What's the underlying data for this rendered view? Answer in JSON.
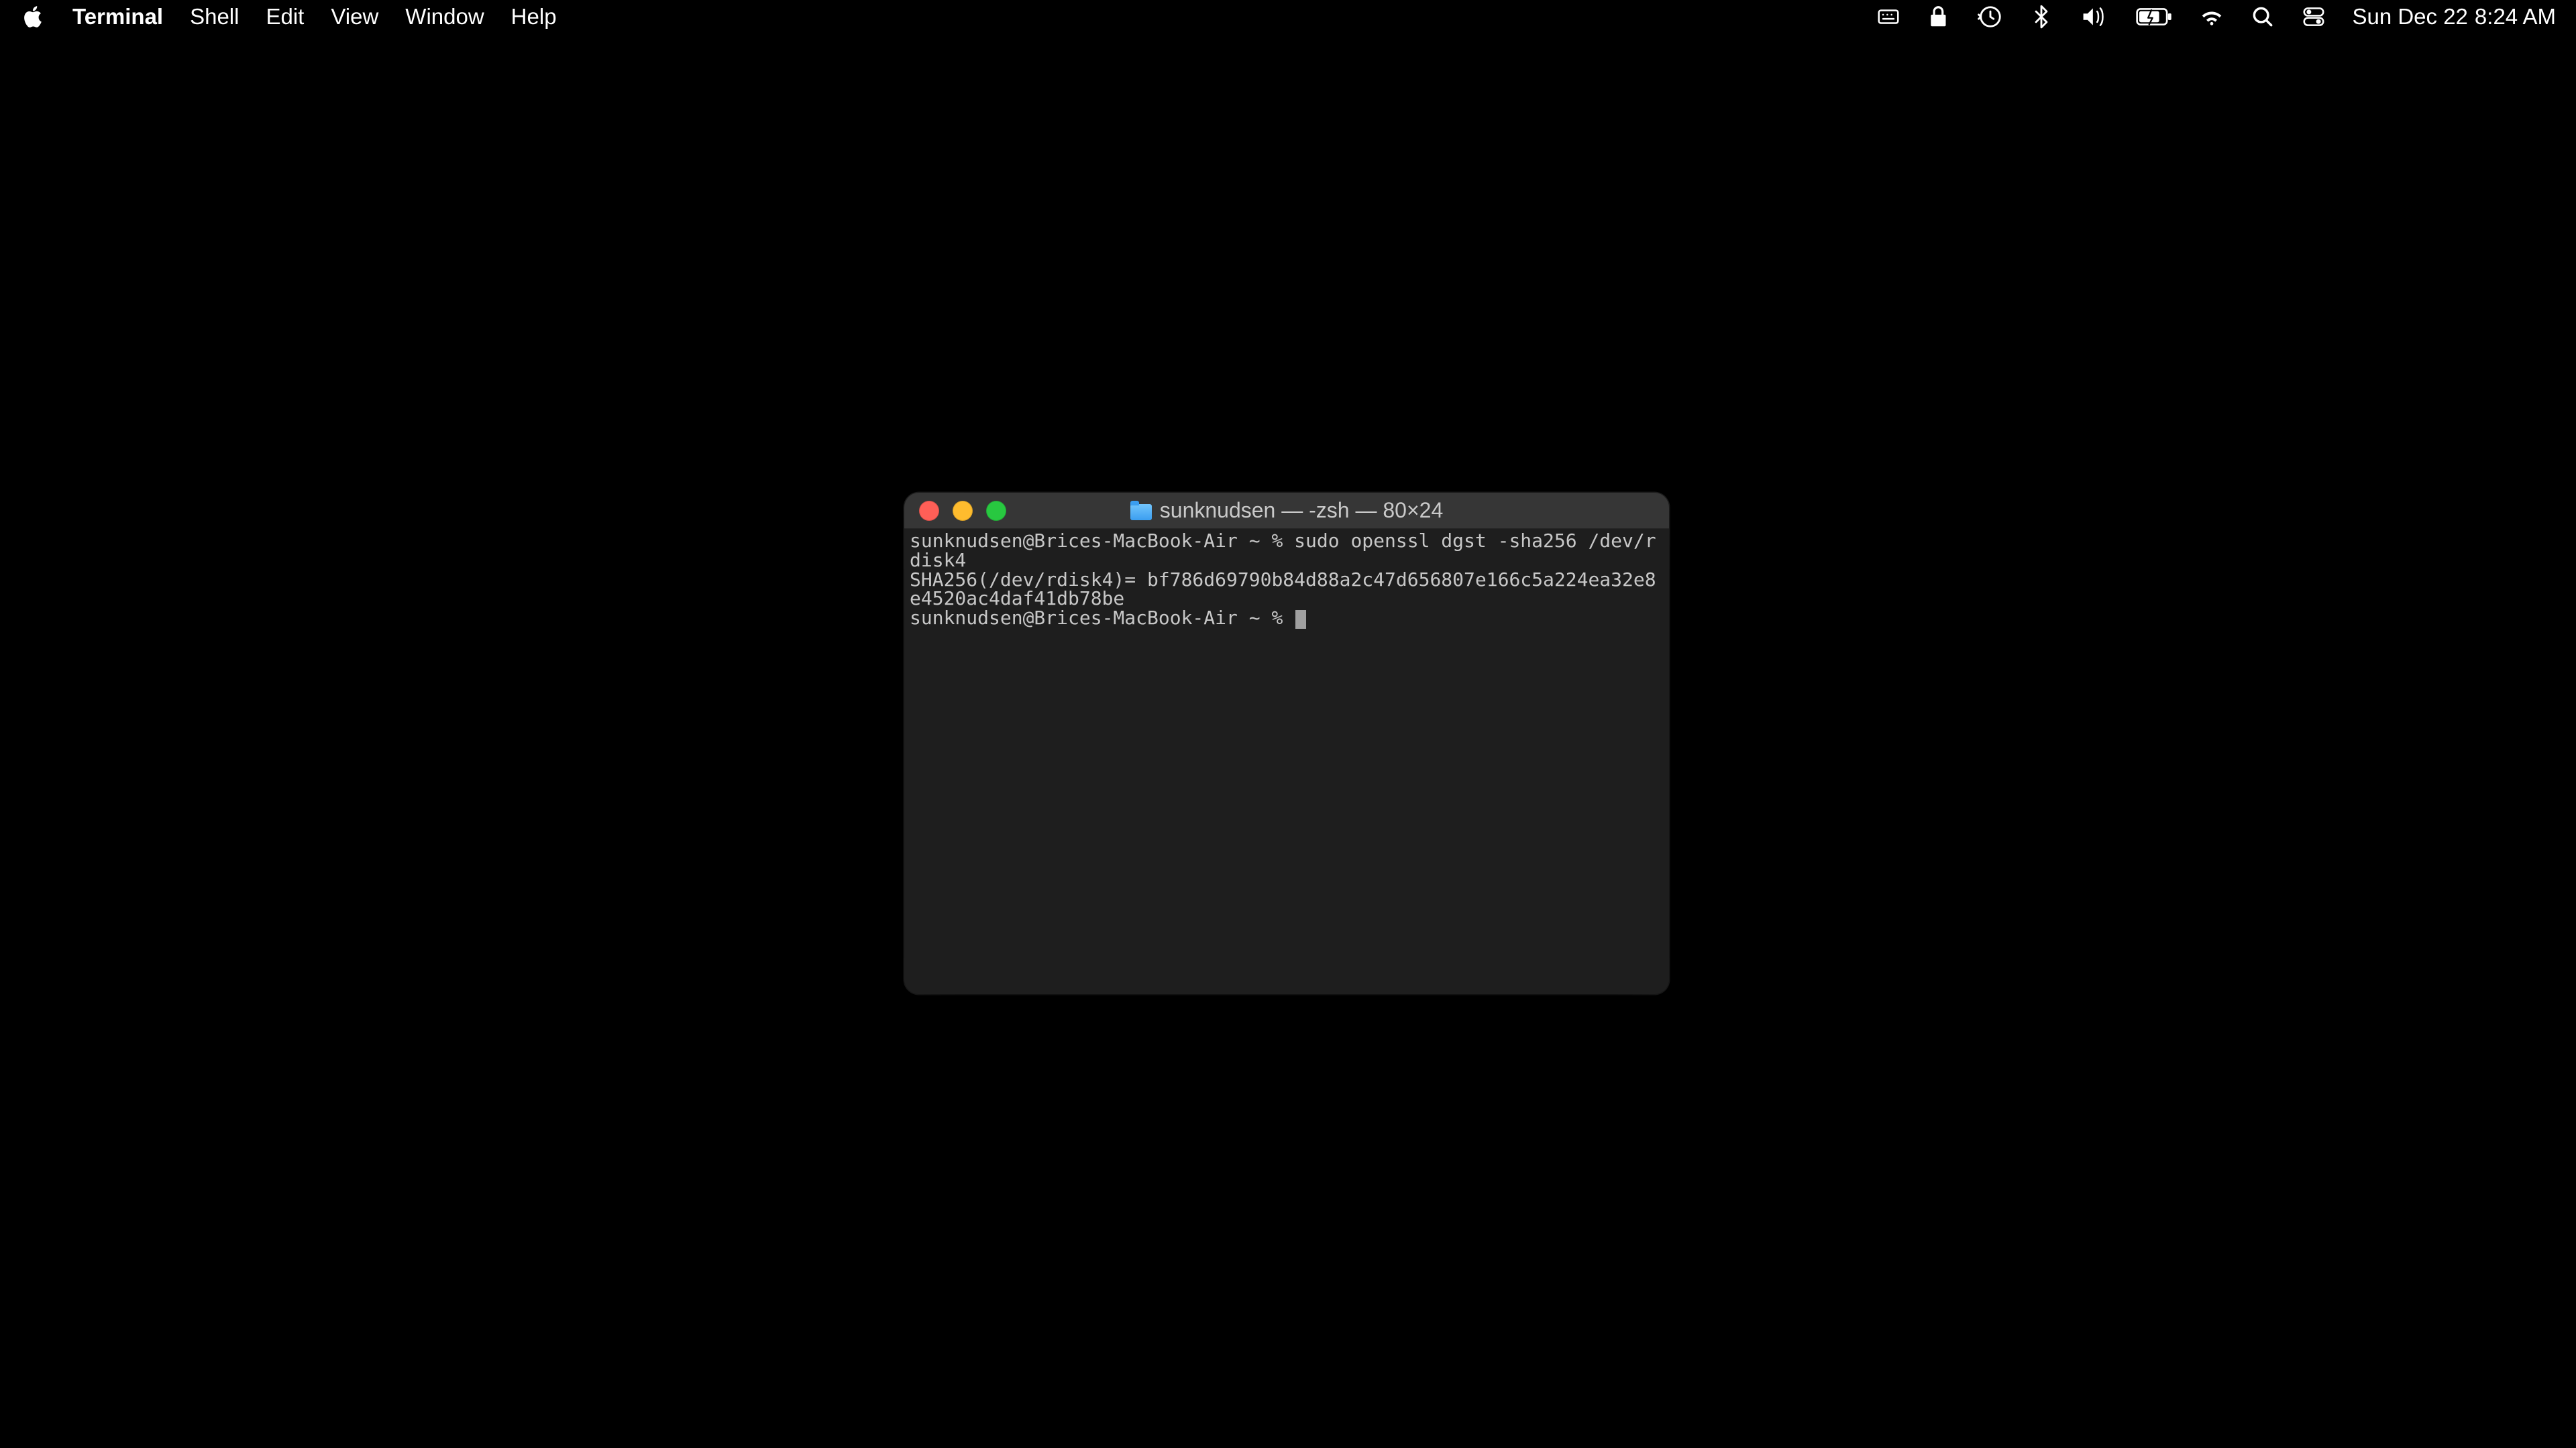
{
  "menubar": {
    "app_name": "Terminal",
    "items": [
      "Shell",
      "Edit",
      "View",
      "Window",
      "Help"
    ],
    "date": "Sun Dec 22",
    "time": "8:24 AM"
  },
  "terminal": {
    "title": "sunknudsen — -zsh — 80×24",
    "lines": [
      "sunknudsen@Brices-MacBook-Air ~ % sudo openssl dgst -sha256 /dev/rdisk4",
      "SHA256(/dev/rdisk4)= bf786d69790b84d88a2c47d656807e166c5a224ea32e8e4520ac4daf41db78be",
      "sunknudsen@Brices-MacBook-Air ~ % "
    ]
  },
  "icons": {
    "apple": "apple-logo-icon",
    "keyboard": "keyboard-brightness-icon",
    "lock": "lock-icon",
    "timemachine": "time-machine-icon",
    "bluetooth": "bluetooth-icon",
    "volume": "volume-icon",
    "battery": "battery-icon",
    "wifi": "wifi-icon",
    "search": "search-icon",
    "control": "control-center-icon"
  }
}
